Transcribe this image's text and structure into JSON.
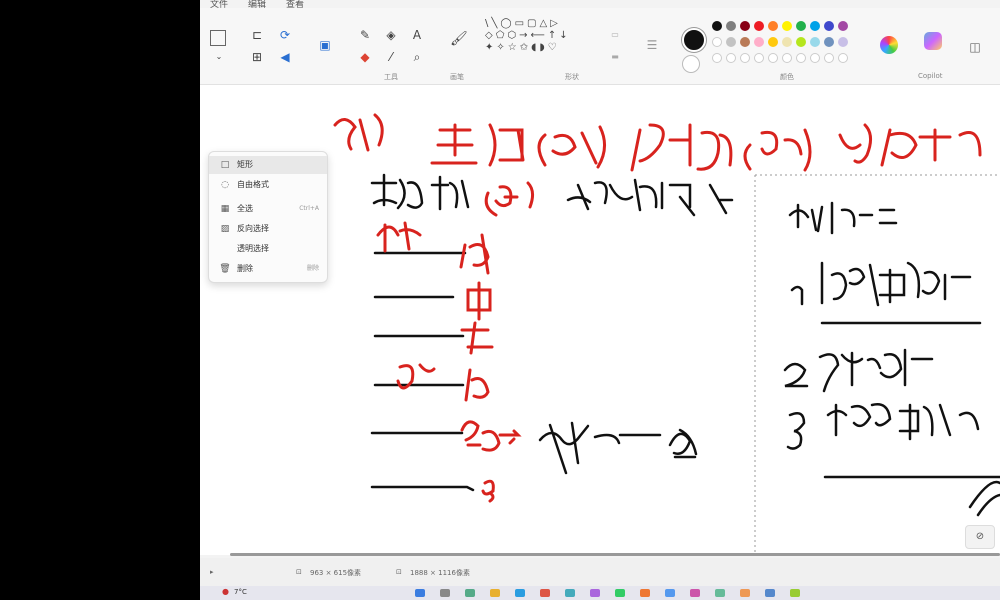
{
  "menu": {
    "items": [
      "文件",
      "编辑",
      "查看"
    ]
  },
  "ribbon": {
    "groups": {
      "tools_label": "工具",
      "brushes_label": "画笔",
      "shapes_label": "形状",
      "colors_label": "颜色",
      "copilot_label": "Copilot"
    },
    "tool_text_icon": "A",
    "colors": [
      "#111111",
      "#7f7f7f",
      "#880015",
      "#ed1c24",
      "#ff7f27",
      "#fff200",
      "#22b14c",
      "#00a2e8",
      "#3f48cc",
      "#a349a4"
    ],
    "colors_row2": [
      "#ffffff",
      "#c3c3c3",
      "#b97a57",
      "#ffaec9",
      "#ffc90e",
      "#efe4b0",
      "#b5e61d",
      "#99d9ea",
      "#7092be",
      "#c8bfe7"
    ]
  },
  "select_menu": {
    "items": [
      {
        "icon": "□",
        "label": "矩形",
        "shortcut": ""
      },
      {
        "icon": "◌",
        "label": "自由格式",
        "shortcut": ""
      },
      {
        "icon": "▦",
        "label": "全选",
        "shortcut": "Ctrl+A"
      },
      {
        "icon": "▨",
        "label": "反向选择",
        "shortcut": ""
      },
      {
        "icon": "",
        "label": "透明选择",
        "shortcut": ""
      },
      {
        "icon": "🗑",
        "label": "删除",
        "shortcut": "删除"
      }
    ]
  },
  "statusbar": {
    "position": "963 × 615像素",
    "canvas_size": "1888 × 1116像素"
  },
  "taskbar": {
    "weather": "7°C"
  }
}
